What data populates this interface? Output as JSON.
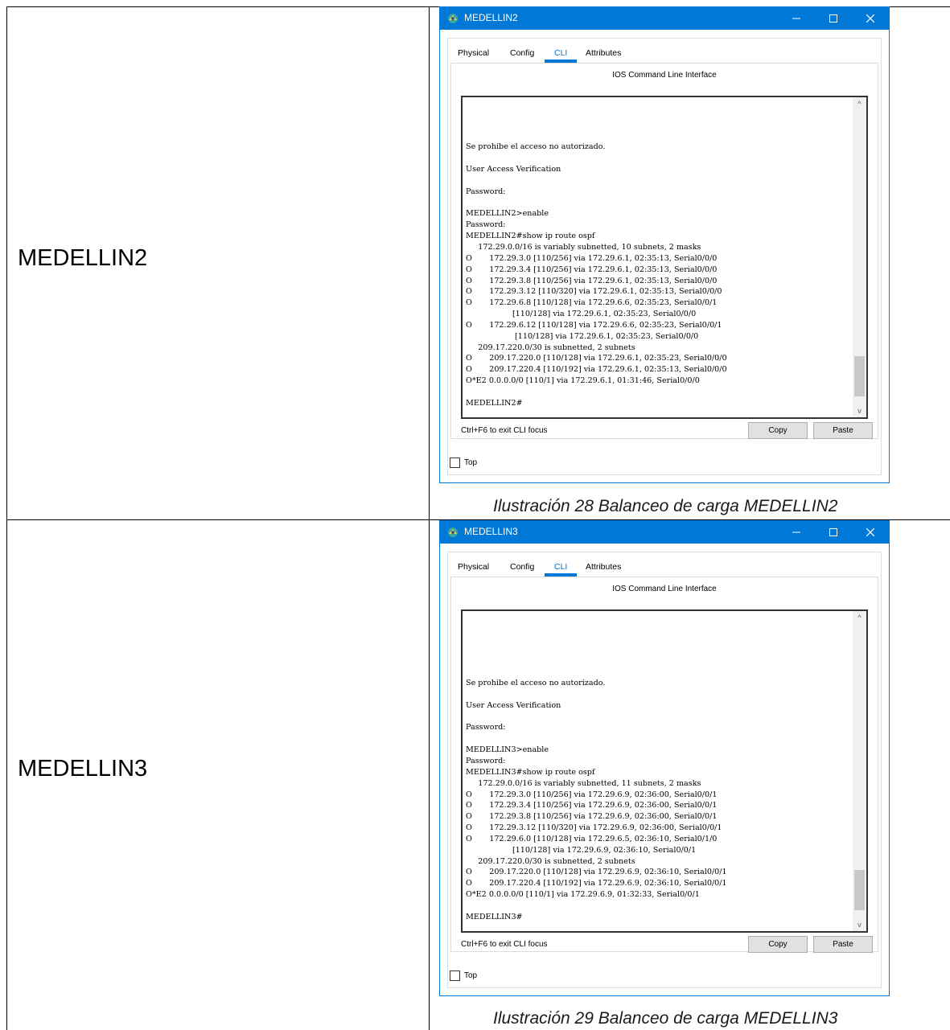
{
  "rows": [
    {
      "label": "MEDELLIN2",
      "caption": "Ilustración 28 Balanceo de carga MEDELLIN2",
      "window": {
        "title": "MEDELLIN2",
        "tabs": [
          "Physical",
          "Config",
          "CLI",
          "Attributes"
        ],
        "active_tab": "CLI",
        "pane_title": "IOS Command Line Interface",
        "terminal": "\n\n\n\nSe prohibe el acceso no autorizado.\n\nUser Access Verification\n\nPassword:\n\nMEDELLIN2>enable\nPassword:\nMEDELLIN2#show ip route ospf\n     172.29.0.0/16 is variably subnetted, 10 subnets, 2 masks\nO       172.29.3.0 [110/256] via 172.29.6.1, 02:35:13, Serial0/0/0\nO       172.29.3.4 [110/256] via 172.29.6.1, 02:35:13, Serial0/0/0\nO       172.29.3.8 [110/256] via 172.29.6.1, 02:35:13, Serial0/0/0\nO       172.29.3.12 [110/320] via 172.29.6.1, 02:35:13, Serial0/0/0\nO       172.29.6.8 [110/128] via 172.29.6.6, 02:35:23, Serial0/0/1\n                   [110/128] via 172.29.6.1, 02:35:23, Serial0/0/0\nO       172.29.6.12 [110/128] via 172.29.6.6, 02:35:23, Serial0/0/1\n                    [110/128] via 172.29.6.1, 02:35:23, Serial0/0/0\n     209.17.220.0/30 is subnetted, 2 subnets\nO       209.17.220.0 [110/128] via 172.29.6.1, 02:35:23, Serial0/0/0\nO       209.17.220.4 [110/192] via 172.29.6.1, 02:35:13, Serial0/0/0\nO*E2 0.0.0.0/0 [110/1] via 172.29.6.1, 01:31:46, Serial0/0/0\n\nMEDELLIN2#",
        "cli_hint": "Ctrl+F6 to exit CLI focus",
        "copy_label": "Copy",
        "paste_label": "Paste",
        "top_label": "Top"
      }
    },
    {
      "label": "MEDELLIN3",
      "caption": "Ilustración 29 Balanceo de carga MEDELLIN3",
      "window": {
        "title": "MEDELLIN3",
        "tabs": [
          "Physical",
          "Config",
          "CLI",
          "Attributes"
        ],
        "active_tab": "CLI",
        "pane_title": "IOS Command Line Interface",
        "terminal": "\n\n\n\n\n\nSe prohibe el acceso no autorizado.\n\nUser Access Verification\n\nPassword:\n\nMEDELLIN3>enable\nPassword:\nMEDELLIN3#show ip route ospf\n     172.29.0.0/16 is variably subnetted, 11 subnets, 2 masks\nO       172.29.3.0 [110/256] via 172.29.6.9, 02:36:00, Serial0/0/1\nO       172.29.3.4 [110/256] via 172.29.6.9, 02:36:00, Serial0/0/1\nO       172.29.3.8 [110/256] via 172.29.6.9, 02:36:00, Serial0/0/1\nO       172.29.3.12 [110/320] via 172.29.6.9, 02:36:00, Serial0/0/1\nO       172.29.6.0 [110/128] via 172.29.6.5, 02:36:10, Serial0/1/0\n                   [110/128] via 172.29.6.9, 02:36:10, Serial0/0/1\n     209.17.220.0/30 is subnetted, 2 subnets\nO       209.17.220.0 [110/128] via 172.29.6.9, 02:36:10, Serial0/0/1\nO       209.17.220.4 [110/192] via 172.29.6.9, 02:36:10, Serial0/0/1\nO*E2 0.0.0.0/0 [110/1] via 172.29.6.9, 01:32:33, Serial0/0/1\n\nMEDELLIN3#",
        "cli_hint": "Ctrl+F6 to exit CLI focus",
        "copy_label": "Copy",
        "paste_label": "Paste",
        "top_label": "Top"
      }
    }
  ]
}
